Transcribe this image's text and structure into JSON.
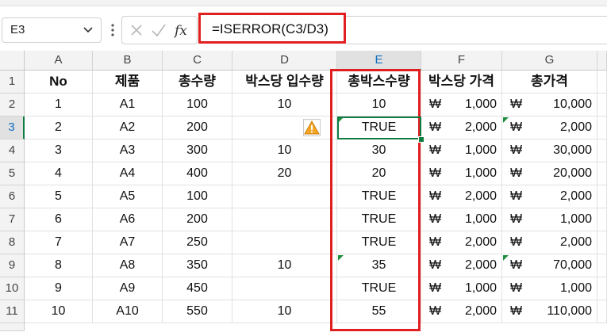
{
  "name_box": {
    "value": "E3"
  },
  "formula_bar": {
    "formula": "=ISERROR(C3/D3)"
  },
  "columns": [
    "A",
    "B",
    "C",
    "D",
    "E",
    "F",
    "G"
  ],
  "rows": [
    "1",
    "2",
    "3",
    "4",
    "5",
    "6",
    "7",
    "8",
    "9",
    "10",
    "11"
  ],
  "headers": {
    "A": "No",
    "B": "제품",
    "C": "총수량",
    "D": "박스당 입수량",
    "E": "총박스수량",
    "F": "박스당 가격",
    "G": "총가격"
  },
  "currency_symbol": "₩",
  "data_rows": [
    {
      "A": "1",
      "B": "A1",
      "C": "100",
      "D": "10",
      "E": "10",
      "F": "1,000",
      "G": "10,000"
    },
    {
      "A": "2",
      "B": "A2",
      "C": "200",
      "D": "",
      "E": "TRUE",
      "F": "2,000",
      "G": "2,000"
    },
    {
      "A": "3",
      "B": "A3",
      "C": "300",
      "D": "10",
      "E": "30",
      "F": "1,000",
      "G": "30,000"
    },
    {
      "A": "4",
      "B": "A4",
      "C": "400",
      "D": "20",
      "E": "20",
      "F": "1,000",
      "G": "20,000"
    },
    {
      "A": "5",
      "B": "A5",
      "C": "100",
      "D": "",
      "E": "TRUE",
      "F": "2,000",
      "G": "2,000"
    },
    {
      "A": "6",
      "B": "A6",
      "C": "200",
      "D": "",
      "E": "TRUE",
      "F": "1,000",
      "G": "1,000"
    },
    {
      "A": "7",
      "B": "A7",
      "C": "250",
      "D": "",
      "E": "TRUE",
      "F": "2,000",
      "G": "2,000"
    },
    {
      "A": "8",
      "B": "A8",
      "C": "350",
      "D": "10",
      "E": "35",
      "F": "2,000",
      "G": "70,000"
    },
    {
      "A": "9",
      "B": "A9",
      "C": "450",
      "D": "",
      "E": "TRUE",
      "F": "1,000",
      "G": "1,000"
    },
    {
      "A": "10",
      "B": "A10",
      "C": "550",
      "D": "10",
      "E": "55",
      "F": "2,000",
      "G": "110,000"
    }
  ],
  "colors": {
    "selection_green": "#107c41",
    "highlight_red": "#e02020",
    "warning_orange": "#f5a623"
  }
}
